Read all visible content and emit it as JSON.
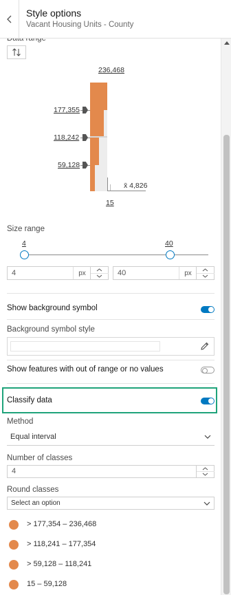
{
  "header": {
    "title": "Style options",
    "subtitle": "Vacant Housing Units - County"
  },
  "data_range": {
    "label": "Data range",
    "max_label": "236,468",
    "handle_values": [
      "177,355",
      "118,242",
      "59,128"
    ],
    "average_label": "x̄ 4,826",
    "min_label": "15"
  },
  "size_range": {
    "label": "Size range",
    "min_handle": "4",
    "max_handle": "40",
    "min_value": "4",
    "max_value": "40",
    "unit": "px"
  },
  "background_symbol": {
    "toggle_label": "Show background symbol",
    "toggle_on": true,
    "style_label": "Background symbol style"
  },
  "out_of_range": {
    "toggle_label": "Show features with out of range or no values",
    "toggle_on": false
  },
  "classify": {
    "toggle_label": "Classify data",
    "toggle_on": true,
    "method_label": "Method",
    "method_value": "Equal interval",
    "classes_label": "Number of classes",
    "classes_value": "4",
    "round_label": "Round classes",
    "round_placeholder": "Select an option"
  },
  "class_breaks": [
    "> 177,354 – 236,468",
    "> 118,241 – 177,354",
    "> 59,128 – 118,241",
    "15 – 59,128"
  ],
  "colors": {
    "accent": "#0079c1",
    "symbol": "#e3894c",
    "highlight": "#1ea37a"
  },
  "icons": {
    "back": "chevron-left-icon",
    "sort": "sort-arrows-icon",
    "edit": "pencil-icon",
    "dropdown": "chevron-down-icon"
  }
}
